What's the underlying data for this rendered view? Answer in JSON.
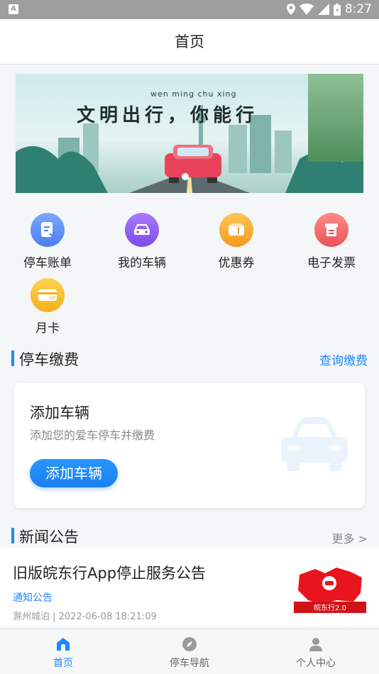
{
  "status_bar": {
    "indicator": "A",
    "time": "8:27"
  },
  "header": {
    "title": "首页"
  },
  "banner": {
    "subtitle": "wen ming chu xing",
    "title": "文明出行，你能行"
  },
  "quick_menu": [
    {
      "label": "停车账单",
      "icon": "bill-icon",
      "color": "#5b8cf6"
    },
    {
      "label": "我的车辆",
      "icon": "car-icon",
      "color": "#8e5cf2"
    },
    {
      "label": "优惠券",
      "icon": "coupon-icon",
      "color": "#f5a623"
    },
    {
      "label": "电子发票",
      "icon": "invoice-icon",
      "color": "#f26b6b"
    },
    {
      "label": "月卡",
      "icon": "vip-card-icon",
      "color": "#f5b731"
    }
  ],
  "parking_section": {
    "title": "停车缴费",
    "link": "查询缴费",
    "card": {
      "title": "添加车辆",
      "description": "添加您的爱车停车并缴费",
      "button": "添加车辆"
    }
  },
  "news_section": {
    "title": "新闻公告",
    "more": "更多 >",
    "items": [
      {
        "title": "旧版皖东行App停止服务公告",
        "tag": "通知公告",
        "meta": "滁州城泊 | 2022-06-08 18:21:09",
        "image_caption": "皖东行2.0"
      }
    ]
  },
  "tab_bar": [
    {
      "label": "首页",
      "icon": "home-icon",
      "active": true
    },
    {
      "label": "停车导航",
      "icon": "compass-icon",
      "active": false
    },
    {
      "label": "个人中心",
      "icon": "user-icon",
      "active": false
    }
  ],
  "colors": {
    "accent": "#1e88ff"
  }
}
